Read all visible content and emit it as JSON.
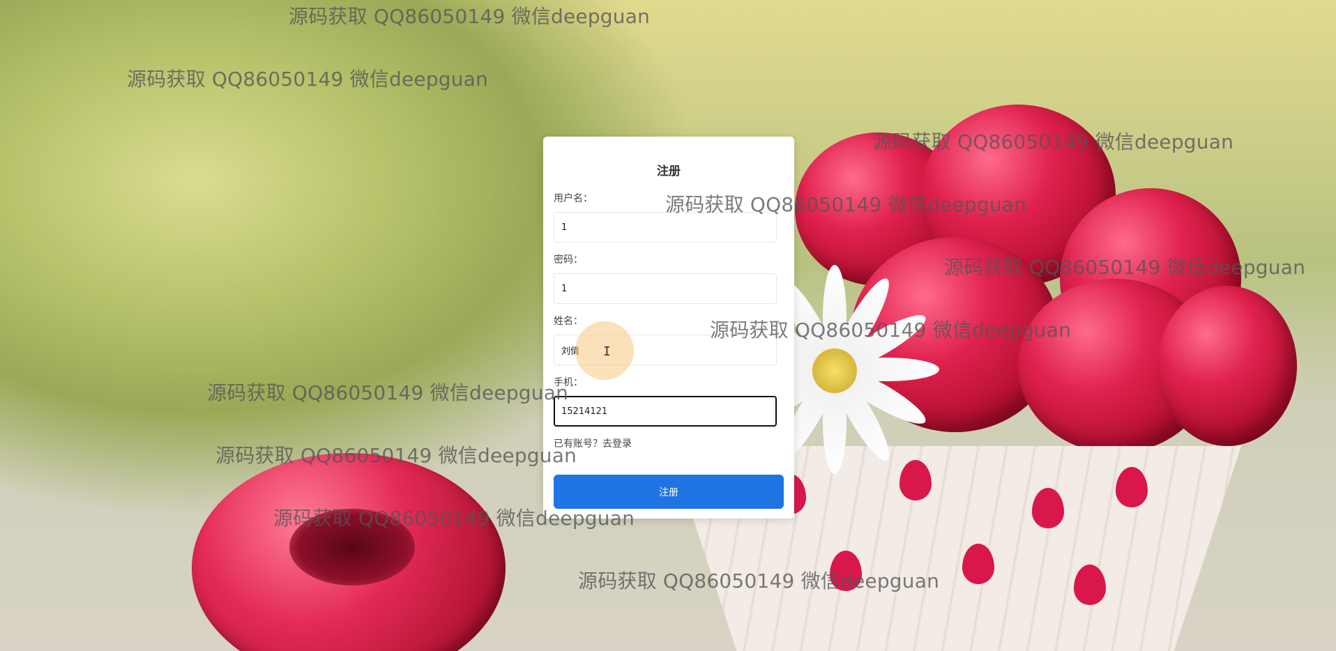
{
  "form": {
    "title": "注册",
    "fields": [
      {
        "label": "用户名：",
        "value": "1"
      },
      {
        "label": "密码：",
        "value": "1"
      },
      {
        "label": "姓名：",
        "value": "刘倩"
      },
      {
        "label": "手机：",
        "value": "15214121"
      }
    ],
    "login_link": "已有账号？去登录",
    "submit_label": "注册"
  },
  "watermark": {
    "text": "源码获取 QQ86050149 微信deepguan"
  },
  "colors": {
    "primary_button": "#1f74e4",
    "card_background": "#ffffff",
    "focused_border": "#111111"
  }
}
